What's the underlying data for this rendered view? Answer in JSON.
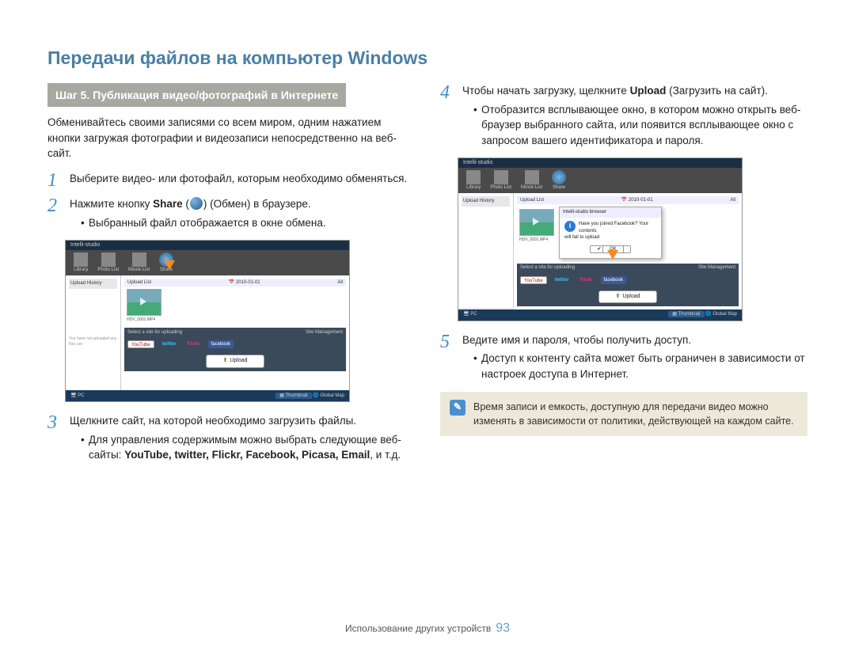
{
  "title": "Передачи файлов на компьютер Windows",
  "step_banner": "Шаг 5. Публикация видео/фотографий в Интернете",
  "intro": "Обменивайтесь своими записями со всем миром, одним нажатием кнопки загружая фотографии и видеозаписи непосредственно на веб-сайт.",
  "steps": {
    "1": {
      "text": "Выберите видео- или фотофайл, которым необходимо обменяться."
    },
    "2": {
      "pre": "Нажмите кнопку ",
      "bold1": "Share",
      "mid": " (",
      "post": ") (Обмен) в браузере.",
      "bullets": [
        "Выбранный файл отображается в окне обмена."
      ]
    },
    "3": {
      "text": "Щелкните сайт, на которой необходимо загрузить файлы.",
      "bullets_pre": "Для управления содержимым можно выбрать следующие веб-сайты: ",
      "bullets_bold": "YouTube, twitter, Flickr, Facebook, Picasa, Email",
      "bullets_post": ", и т.д."
    },
    "4": {
      "pre": "Чтобы начать загрузку, щелкните ",
      "bold": "Upload",
      "post": " (Загрузить на сайт).",
      "bullets": [
        "Отобразится всплывающее окно, в котором можно открыть веб-браузер выбранного сайта, или появится всплывающее окно с запросом вашего идентификатора и пароля."
      ]
    },
    "5": {
      "text": "Ведите имя и пароля, чтобы получить доступ.",
      "bullets": [
        "Доступ к контенту сайта может быть ограничен в зависимости от настроек доступа в Интернет."
      ]
    }
  },
  "note": "Время записи и емкость, доступную для передачи видео можно изменять в зависимости от политики, действующей на каждом сайте.",
  "shot": {
    "app_title": "Intelli-studio",
    "tb_labels": [
      "Library",
      "Photo List",
      "Movie List",
      "Share"
    ],
    "side_title": "Upload History",
    "side_note": "You have not uploaded any files yet",
    "hdr_left": "Upload List",
    "hdr_date": "2010-01-01",
    "hdr_right": "All",
    "thumb_name": "HDV_0001.MP4",
    "sel_left": "Select a site for uploading",
    "sel_right": "Site Management",
    "brand_yt": "YouTube",
    "brand_tw": "twitter",
    "brand_fl": "Flickr",
    "brand_fb": "facebook",
    "upload": "Upload",
    "foot_pc": "PC",
    "foot_thumb": "Thumbnail",
    "foot_global": "Global Map",
    "popup": {
      "head": "Intelli-studio browser",
      "msg1": "Have you joined Facebook? Your contents",
      "msg2": "will fail to upload",
      "ok": "OK",
      "thumb_date": "HDV_0001.MP4"
    }
  },
  "footer_text": "Использование других устройств",
  "page_num": "93"
}
